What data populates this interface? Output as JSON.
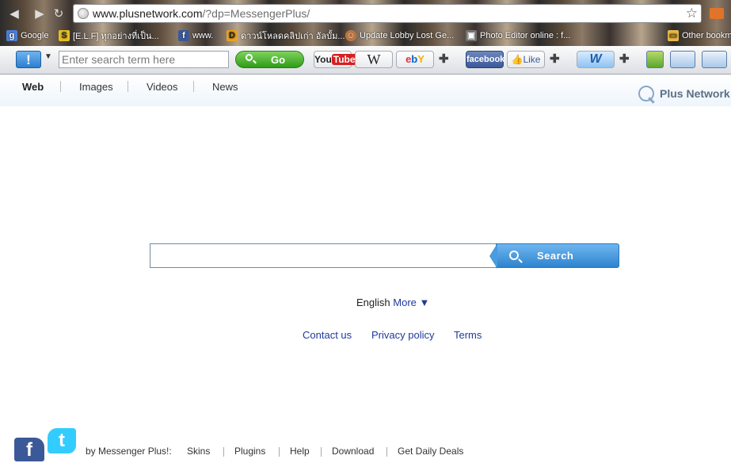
{
  "browser": {
    "url_domain": "www.plusnetwork.com",
    "url_rest": "/?dp=MessengerPlus/"
  },
  "bookmarks": [
    {
      "label": "Google",
      "icon": "google-icon",
      "color": "#4a7fd8"
    },
    {
      "label": "[E.L.F] ทุกอย่างที่เป็น...",
      "icon": "elf-icon",
      "color": "#e8c021"
    },
    {
      "label": "www.",
      "icon": "facebook-icon",
      "color": "#3b5998"
    },
    {
      "label": "ดาวน์โหลดคลิปเก่า อัลบั้ม...",
      "icon": "d-icon",
      "color": "#e8a321"
    },
    {
      "label": "Update Lobby Lost Ge...",
      "icon": "face-icon",
      "color": "#c4773b"
    },
    {
      "label": "Photo Editor online : f...",
      "icon": "photo-icon",
      "color": "#7a7a7a"
    },
    {
      "label": "Other bookm",
      "icon": "folder-icon",
      "color": "#e8b84a"
    }
  ],
  "toolbar": {
    "info_label": "!",
    "search_placeholder": "Enter search term here",
    "go_label": "Go",
    "youtube_label": "YouTube",
    "wikipedia_label": "W",
    "ebay_label": "ebY",
    "facebook_label": "facebook",
    "like_label": "Like",
    "word_label": "W"
  },
  "tabs": [
    {
      "label": "Web",
      "active": true
    },
    {
      "label": "Images",
      "active": false
    },
    {
      "label": "Videos",
      "active": false
    },
    {
      "label": "News",
      "active": false
    }
  ],
  "brand": {
    "name": "Plus Network"
  },
  "search": {
    "value": "",
    "button_label": "Search"
  },
  "language": {
    "current": "English",
    "more_label": "More ▼"
  },
  "links": {
    "contact": "Contact us",
    "privacy": "Privacy policy",
    "terms": "Terms"
  },
  "footer": {
    "by_text": "by Messenger Plus!:",
    "links": [
      "Skins",
      "Plugins",
      "Help",
      "Download",
      "Get Daily Deals"
    ]
  },
  "colors": {
    "link": "#1f3a9c",
    "accent_blue": "#2e84cf",
    "go_green": "#2f9b18"
  }
}
